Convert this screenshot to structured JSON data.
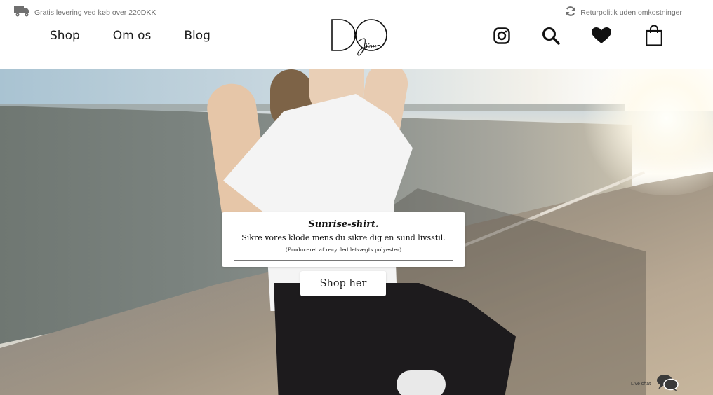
{
  "topbar": {
    "shipping_text": "Gratis levering ved køb over 220DKK",
    "returns_text": "Returpolitik uden omkostninger"
  },
  "nav": {
    "items": [
      {
        "label": "Shop"
      },
      {
        "label": "Om os"
      },
      {
        "label": "Blog"
      }
    ]
  },
  "logo": {
    "letters": "DO",
    "script": "You"
  },
  "header_icons": [
    "instagram-icon",
    "search-icon",
    "heart-icon",
    "shopping-bag-icon"
  ],
  "hero": {
    "title": "Sunrise-shirt.",
    "subtitle": "Sikre vores klode mens du sikre dig en sund livsstil.",
    "note": "(Produceret af recycled letvægts polyester)",
    "button_label": "Shop her"
  },
  "livechat": {
    "label": "Live chat"
  },
  "colors": {
    "text": "#1c1c1c",
    "muted": "#6f6f6f",
    "card_bg": "#ffffff"
  }
}
